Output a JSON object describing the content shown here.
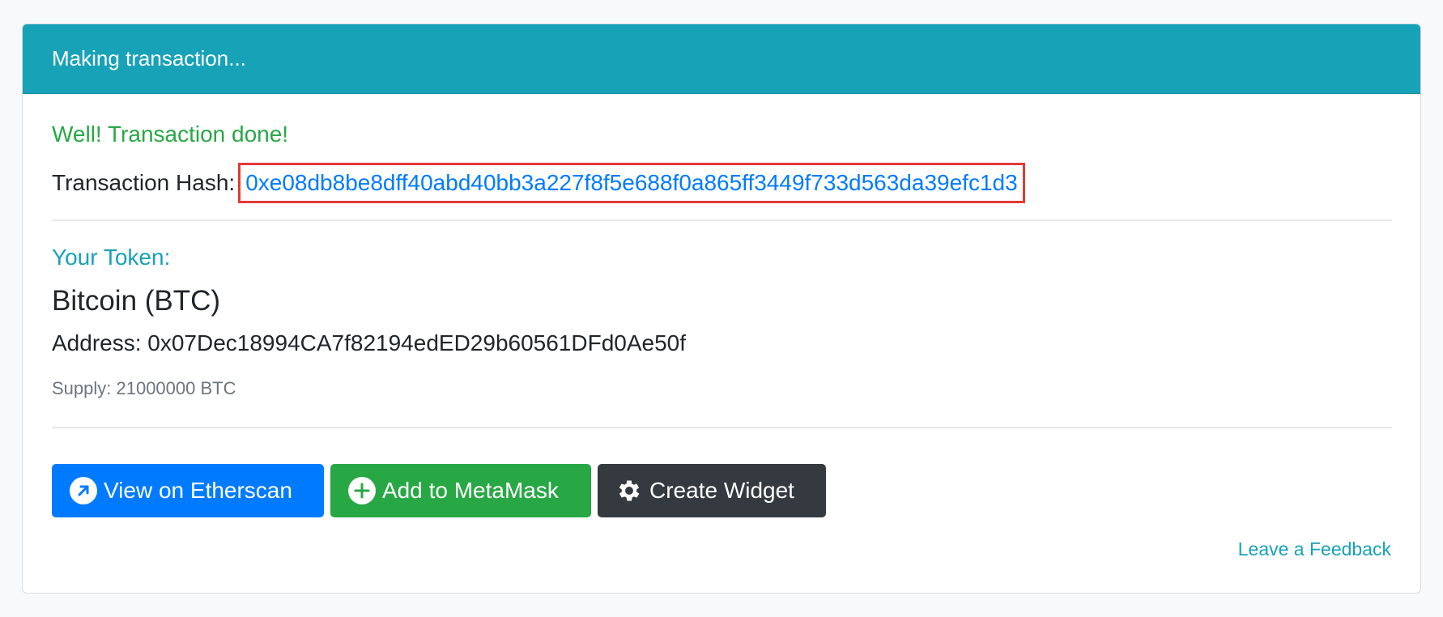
{
  "header": {
    "title": "Making transaction..."
  },
  "result": {
    "success_message": "Well! Transaction done!",
    "hash_label": "Transaction Hash:",
    "hash_value": "0xe08db8be8dff40abd40bb3a227f8f5e688f0a865ff3449f733d563da39efc1d3"
  },
  "token": {
    "section_label": "Your Token:",
    "name": "Bitcoin (BTC)",
    "address_text": "Address: 0x07Dec18994CA7f82194edED29b60561DFd0Ae50f",
    "supply_text": "Supply: 21000000 BTC"
  },
  "actions": {
    "etherscan_label": "View on Etherscan",
    "metamask_label": "Add to MetaMask",
    "widget_label": "Create Widget"
  },
  "footer": {
    "feedback_label": "Leave a Feedback"
  },
  "colors": {
    "header": "#17a2b8",
    "success": "#28a745",
    "primary": "#007bff",
    "dark": "#343a40",
    "highlight": "#e53935"
  },
  "icons": {
    "etherscan": "external-link-circle-icon",
    "metamask": "plus-circle-icon",
    "widget": "gear-icon"
  }
}
